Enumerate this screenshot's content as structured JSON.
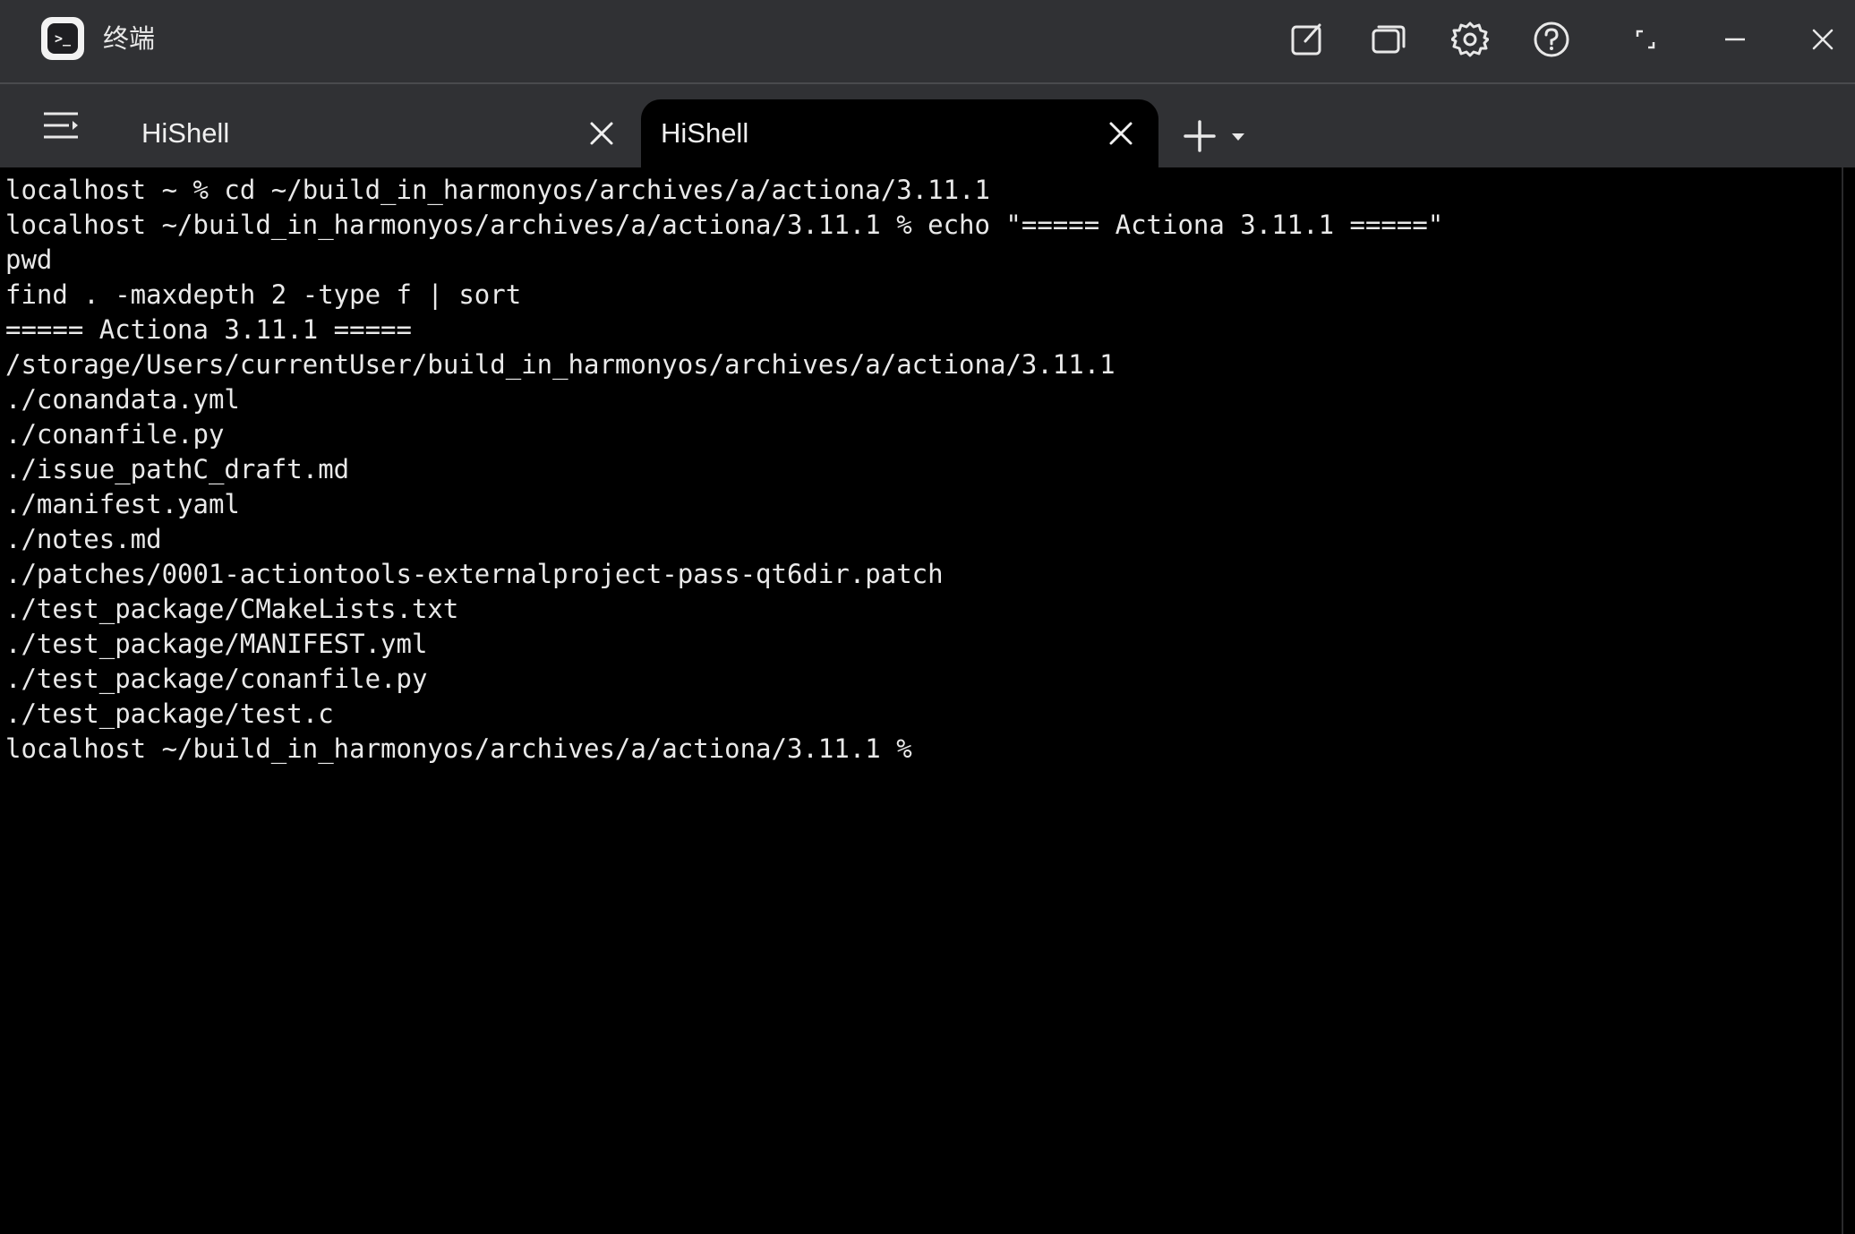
{
  "window": {
    "title": "终端",
    "app_icon_glyph": ">_",
    "icons": {
      "app": "terminal-app-icon",
      "new_window": "edit-square-icon",
      "multi_window": "windows-icon",
      "settings": "gear-icon",
      "help": "help-circle-icon",
      "restore": "restore-icon",
      "minimize": "minimize-icon",
      "close": "close-icon"
    }
  },
  "tabbar": {
    "menu_icon": "menu-icon",
    "tabs": [
      {
        "label": "HiShell",
        "active": false
      },
      {
        "label": "HiShell",
        "active": true
      }
    ],
    "new_tab_icon": "plus-icon",
    "dropdown_icon": "caret-down-icon"
  },
  "terminal": {
    "lines": [
      "localhost ~ % cd ~/build_in_harmonyos/archives/a/actiona/3.11.1",
      "localhost ~/build_in_harmonyos/archives/a/actiona/3.11.1 % echo \"===== Actiona 3.11.1 =====\"",
      "pwd",
      "find . -maxdepth 2 -type f | sort",
      "===== Actiona 3.11.1 =====",
      "/storage/Users/currentUser/build_in_harmonyos/archives/a/actiona/3.11.1",
      "./conandata.yml",
      "./conanfile.py",
      "./issue_pathC_draft.md",
      "./manifest.yaml",
      "./notes.md",
      "./patches/0001-actiontools-externalproject-pass-qt6dir.patch",
      "./test_package/CMakeLists.txt",
      "./test_package/MANIFEST.yml",
      "./test_package/conanfile.py",
      "./test_package/test.c",
      "localhost ~/build_in_harmonyos/archives/a/actiona/3.11.1 %"
    ]
  },
  "colors": {
    "chrome": "#303134",
    "terminal_bg": "#000000",
    "text": "#e9e9e9"
  }
}
